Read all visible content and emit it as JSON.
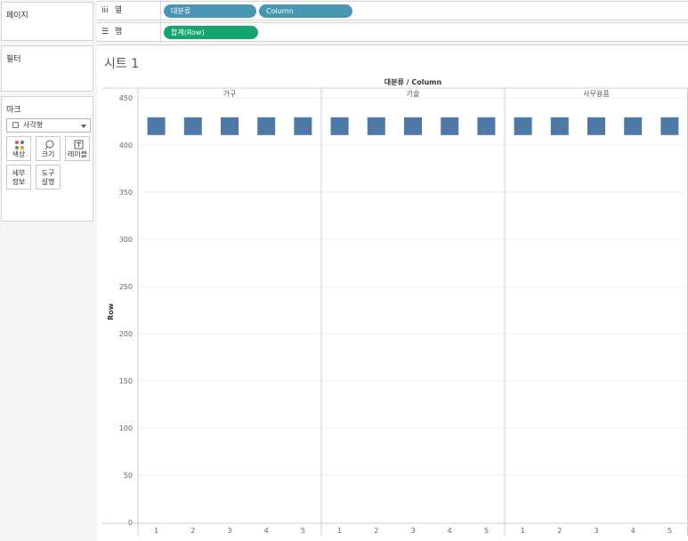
{
  "panes": {
    "pages_title": "페이지",
    "filters_title": "필터",
    "marks_title": "마크",
    "mark_type": "사각형",
    "mark_buttons": {
      "color": "색상",
      "size": "크기",
      "label": "레이블",
      "detail_l1": "세부",
      "detail_l2": "정보",
      "tooltip_l1": "도구",
      "tooltip_l2": "설명"
    }
  },
  "shelves": {
    "columns_label": "열",
    "rows_label": "행",
    "columns_pills": [
      "대분류",
      "Column"
    ],
    "rows_pills": [
      "합계(Row)"
    ]
  },
  "colors": {
    "mark": "#4e79a7",
    "dimension_pill": "#4996b2",
    "measure_pill": "#15a36f"
  },
  "sheet_title": "시트 1",
  "chart_data": {
    "type": "bar",
    "mark": "square",
    "header_title": "대분류 / Column",
    "panels": [
      "가구",
      "기술",
      "사무용품"
    ],
    "categories": [
      "1",
      "2",
      "3",
      "4",
      "5"
    ],
    "series": [
      {
        "panel": "가구",
        "values": [
          420,
          420,
          420,
          420,
          420
        ]
      },
      {
        "panel": "기술",
        "values": [
          420,
          420,
          420,
          420,
          420
        ]
      },
      {
        "panel": "사무용품",
        "values": [
          420,
          420,
          420,
          420,
          420
        ]
      }
    ],
    "ylabel": "Row",
    "ylim": [
      0,
      450
    ],
    "yticks": [
      0,
      50,
      100,
      150,
      200,
      250,
      300,
      350,
      400,
      450
    ],
    "grid": true
  }
}
